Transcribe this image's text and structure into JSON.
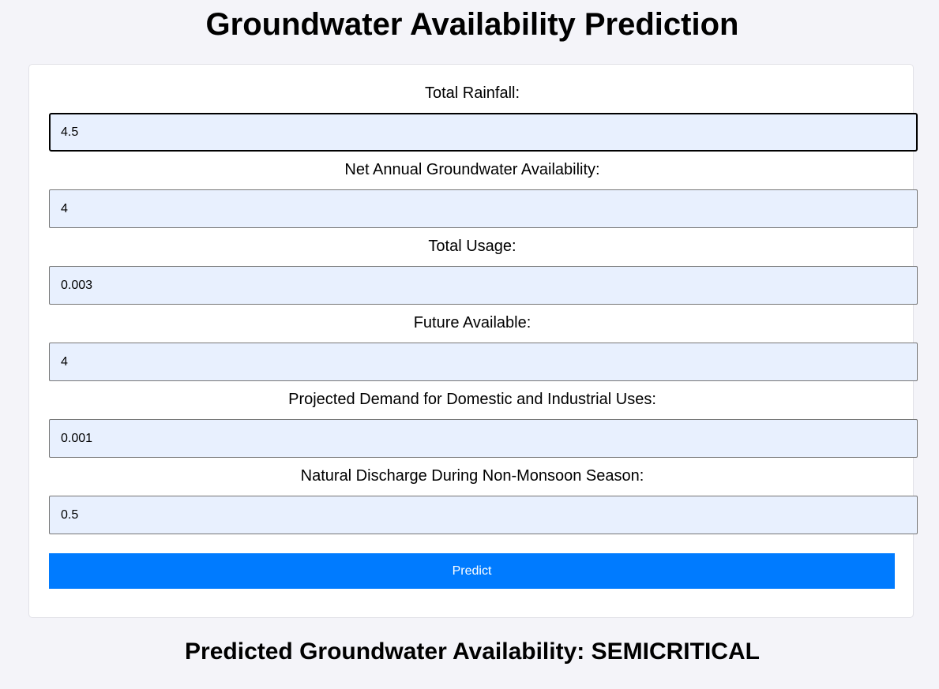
{
  "page": {
    "title": "Groundwater Availability Prediction"
  },
  "form": {
    "fields": [
      {
        "label": "Total Rainfall:",
        "value": "4.5"
      },
      {
        "label": "Net Annual Groundwater Availability:",
        "value": "4"
      },
      {
        "label": "Total Usage:",
        "value": "0.003"
      },
      {
        "label": "Future Available:",
        "value": "4"
      },
      {
        "label": "Projected Demand for Domestic and Industrial Uses:",
        "value": "0.001"
      },
      {
        "label": "Natural Discharge During Non-Monsoon Season:",
        "value": "0.5"
      }
    ],
    "predict_label": "Predict"
  },
  "result": {
    "text": "Predicted Groundwater Availability: SEMICRITICAL"
  },
  "colors": {
    "page_background": "#f4f4f9",
    "card_background": "#ffffff",
    "input_background": "#e8f0fe",
    "button_background": "#007bff",
    "button_text": "#ffffff"
  }
}
